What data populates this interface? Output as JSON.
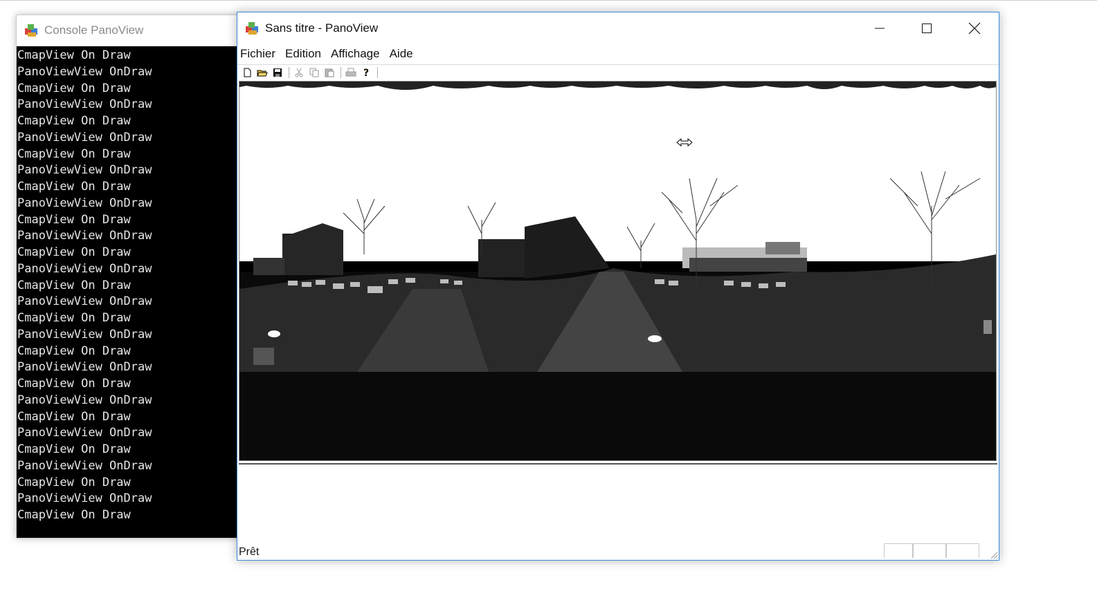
{
  "console": {
    "title": "Console PanoView",
    "lines": [
      "CmapView On Draw",
      "PanoViewView OnDraw",
      "CmapView On Draw",
      "PanoViewView OnDraw",
      "CmapView On Draw",
      "PanoViewView OnDraw",
      "CmapView On Draw",
      "PanoViewView OnDraw",
      "CmapView On Draw",
      "PanoViewView OnDraw",
      "CmapView On Draw",
      "PanoViewView OnDraw",
      "CmapView On Draw",
      "PanoViewView OnDraw",
      "CmapView On Draw",
      "PanoViewView OnDraw",
      "CmapView On Draw",
      "PanoViewView OnDraw",
      "CmapView On Draw",
      "PanoViewView OnDraw",
      "CmapView On Draw",
      "PanoViewView OnDraw",
      "CmapView On Draw",
      "PanoViewView OnDraw",
      "CmapView On Draw",
      "PanoViewView OnDraw",
      "CmapView On Draw",
      "PanoViewView OnDraw",
      "CmapView On Draw"
    ]
  },
  "window": {
    "title": "Sans titre - PanoView",
    "controls": {
      "minimize": "minimize-icon",
      "maximize": "maximize-icon",
      "close": "close-icon"
    }
  },
  "menu": {
    "items": [
      "Fichier",
      "Edition",
      "Affichage",
      "Aide"
    ]
  },
  "toolbar": {
    "icons": [
      "new-file-icon",
      "open-folder-icon",
      "save-icon",
      "cut-icon",
      "copy-icon",
      "paste-icon",
      "print-icon",
      "help-icon"
    ]
  },
  "panorama": {
    "description_icon": "panorama-image",
    "cursor": "resize-horizontal-cursor-icon"
  },
  "status": {
    "text": "Prêt"
  },
  "colors": {
    "window_border": "#3b8ad9",
    "console_bg": "#000000",
    "console_text": "#e6e6e6"
  }
}
